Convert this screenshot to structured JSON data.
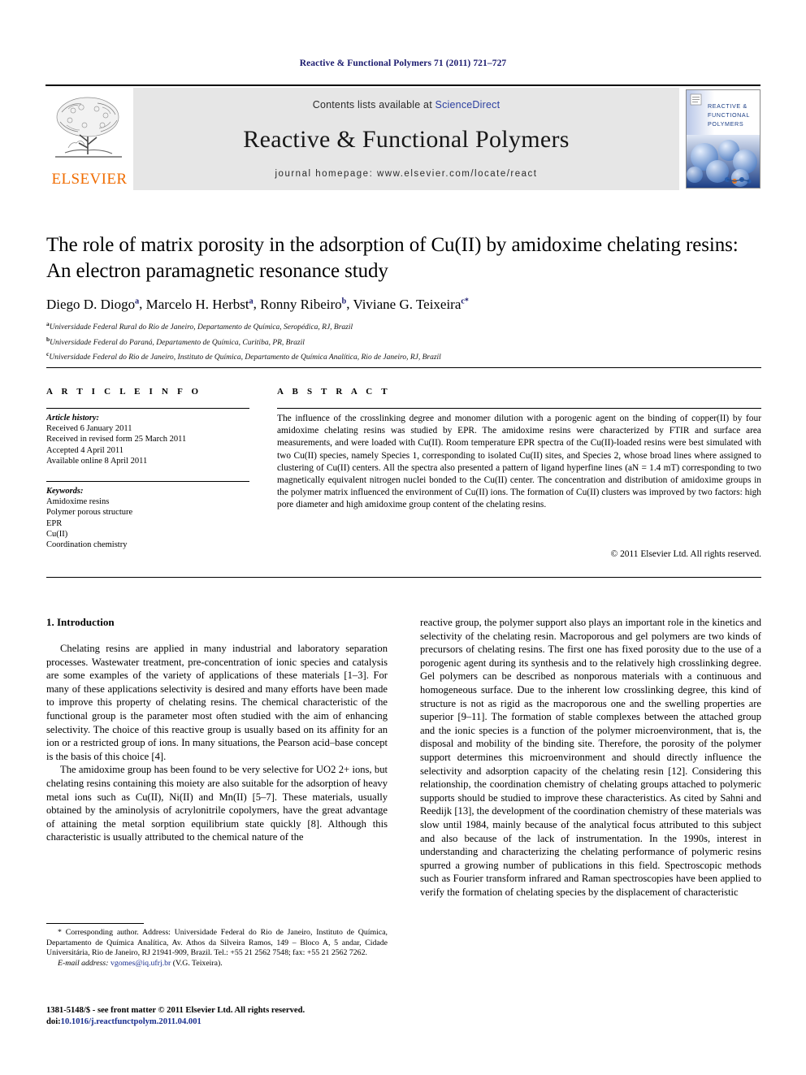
{
  "running_head": "Reactive & Functional Polymers 71 (2011) 721–727",
  "masthead": {
    "contents_prefix": "Contents lists available at ",
    "sciencedirect": "ScienceDirect",
    "journal_name": "Reactive & Functional Polymers",
    "homepage": "journal homepage: www.elsevier.com/locate/react",
    "publisher": "ELSEVIER",
    "cover_title_line1": "REACTIVE &",
    "cover_title_line2": "FUNCTIONAL",
    "cover_title_line3": "POLYMERS",
    "band_bg": "#e6e6e6",
    "elsevier_orange": "#F06C00",
    "link_blue": "#2b3fa0"
  },
  "article": {
    "title": "The role of matrix porosity in the adsorption of Cu(II) by amidoxime chelating resins: An electron paramagnetic resonance study",
    "authors": [
      {
        "name": "Diego D. Diogo",
        "sup": "a"
      },
      {
        "name": "Marcelo H. Herbst",
        "sup": "a"
      },
      {
        "name": "Ronny Ribeiro",
        "sup": "b"
      },
      {
        "name": "Viviane G. Teixeira",
        "sup": "c",
        "corresponding": true
      }
    ],
    "affiliations": [
      {
        "marker": "a",
        "text": "Universidade Federal Rural do Rio de Janeiro, Departamento de Química, Seropédica, RJ, Brazil"
      },
      {
        "marker": "b",
        "text": "Universidade Federal do Paraná, Departamento de Química, Curitiba, PR, Brazil"
      },
      {
        "marker": "c",
        "text": "Universidade Federal do Rio de Janeiro, Instituto de Química, Departamento de Química Analítica, Rio de Janeiro, RJ, Brazil"
      }
    ]
  },
  "article_info": {
    "heading": "A R T I C L E   I N F O",
    "history_label": "Article history:",
    "history": [
      "Received 6 January 2011",
      "Received in revised form 25 March 2011",
      "Accepted 4 April 2011",
      "Available online 8 April 2011"
    ],
    "keywords_label": "Keywords:",
    "keywords": [
      "Amidoxime resins",
      "Polymer porous structure",
      "EPR",
      "Cu(II)",
      "Coordination chemistry"
    ]
  },
  "abstract": {
    "heading": "A B S T R A C T",
    "text": "The influence of the crosslinking degree and monomer dilution with a porogenic agent on the binding of copper(II) by four amidoxime chelating resins was studied by EPR. The amidoxime resins were characterized by FTIR and surface area measurements, and were loaded with Cu(II). Room temperature EPR spectra of the Cu(II)-loaded resins were best simulated with two Cu(II) species, namely Species 1, corresponding to isolated Cu(II) sites, and Species 2, whose broad lines where assigned to clustering of Cu(II) centers. All the spectra also presented a pattern of ligand hyperfine lines (aN = 1.4 mT) corresponding to two magnetically equivalent nitrogen nuclei bonded to the Cu(II) center. The concentration and distribution of amidoxime groups in the polymer matrix influenced the environment of Cu(II) ions. The formation of Cu(II) clusters was improved by two factors: high pore diameter and high amidoxime group content of the chelating resins.",
    "copyright": "© 2011 Elsevier Ltd. All rights reserved."
  },
  "introduction": {
    "heading": "1. Introduction",
    "left_paragraphs": [
      "Chelating resins are applied in many industrial and laboratory separation processes. Wastewater treatment, pre-concentration of ionic species and catalysis are some examples of the variety of applications of these materials [1–3]. For many of these applications selectivity is desired and many efforts have been made to improve this property of chelating resins. The chemical characteristic of the functional group is the parameter most often studied with the aim of enhancing selectivity. The choice of this reactive group is usually based on its affinity for an ion or a restricted group of ions. In many situations, the Pearson acid–base concept is the basis of this choice [4].",
      "The amidoxime group has been found to be very selective for UO2 2+ ions, but chelating resins containing this moiety are also suitable for the adsorption of heavy metal ions such as Cu(II), Ni(II) and Mn(II) [5–7]. These materials, usually obtained by the aminolysis of acrylonitrile copolymers, have the great advantage of attaining the metal sorption equilibrium state quickly [8]. Although this characteristic is usually attributed to the chemical nature of the"
    ],
    "right_paragraph": "reactive group, the polymer support also plays an important role in the kinetics and selectivity of the chelating resin. Macroporous and gel polymers are two kinds of precursors of chelating resins. The first one has fixed porosity due to the use of a porogenic agent during its synthesis and to the relatively high crosslinking degree. Gel polymers can be described as nonporous materials with a continuous and homogeneous surface. Due to the inherent low crosslinking degree, this kind of structure is not as rigid as the macroporous one and the swelling properties are superior [9–11]. The formation of stable complexes between the attached group and the ionic species is a function of the polymer microenvironment, that is, the disposal and mobility of the binding site. Therefore, the porosity of the polymer support determines this microenvironment and should directly influence the selectivity and adsorption capacity of the chelating resin [12]. Considering this relationship, the coordination chemistry of chelating groups attached to polymeric supports should be studied to improve these characteristics. As cited by Sahni and Reedijk [13], the development of the coordination chemistry of these materials was slow until 1984, mainly because of the analytical focus attributed to this subject and also because of the lack of instrumentation. In the 1990s, interest in understanding and characterizing the chelating performance of polymeric resins spurred a growing number of publications in this field. Spectroscopic methods such as Fourier transform infrared and Raman spectroscopies have been applied to verify the formation of chelating species by the displacement of characteristic"
  },
  "footnote": {
    "corresponding_mark": "*",
    "corresponding_text": "Corresponding author. Address: Universidade Federal do Rio de Janeiro, Instituto de Química, Departamento de Química Analítica, Av. Athos da Silveira Ramos, 149 – Bloco A, 5 andar, Cidade Universitária, Rio de Janeiro, RJ 21941-909, Brazil. Tel.: +55 21 2562 7548; fax: +55 21 2562 7262.",
    "email_label": "E-mail address:",
    "email": "vgomes@iq.ufrj.br",
    "email_owner": "(V.G. Teixeira)."
  },
  "colophon": {
    "issn_line": "1381-5148/$ - see front matter © 2011 Elsevier Ltd. All rights reserved.",
    "doi_label": "doi:",
    "doi": "10.1016/j.reactfunctpolym.2011.04.001"
  }
}
